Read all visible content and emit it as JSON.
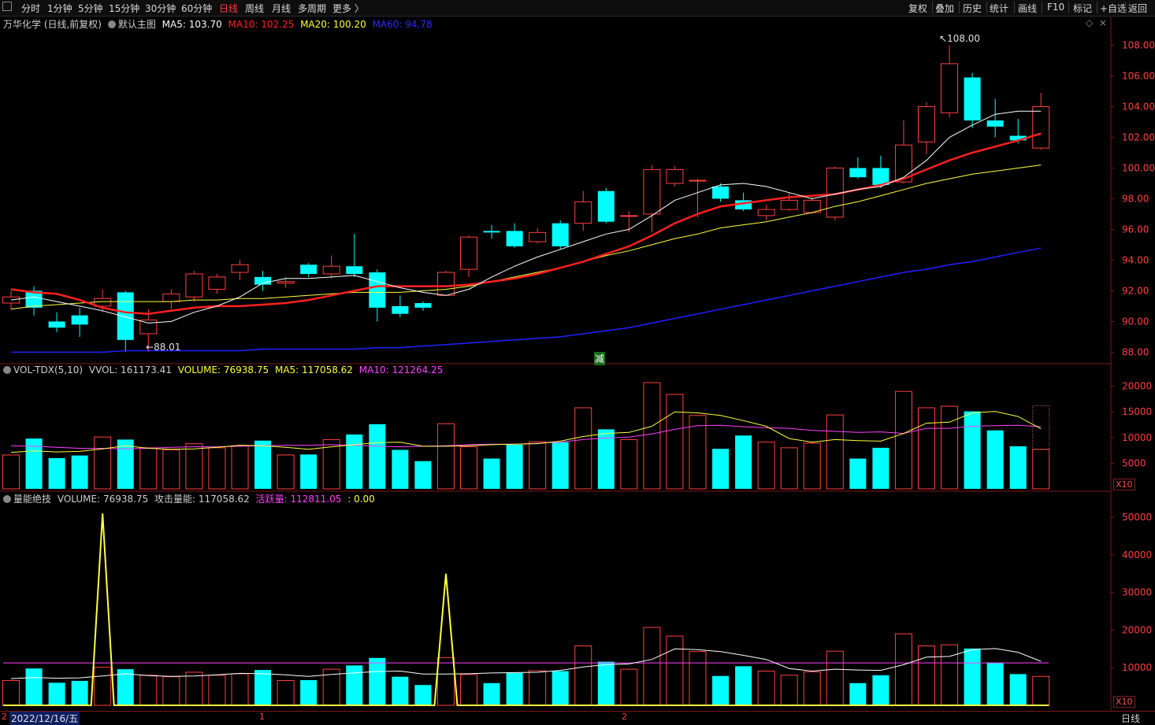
{
  "toolbar": {
    "left_icon": "sidebar-toggle-icon",
    "periods": [
      "分时",
      "1分钟",
      "5分钟",
      "15分钟",
      "30分钟",
      "60分钟",
      "日线",
      "周线",
      "月线",
      "多周期",
      "更多 〉"
    ],
    "active_period": "日线",
    "right_buttons": [
      "复权",
      "叠加",
      "历史",
      "统计",
      "画线",
      "F10",
      "标记",
      "+自选",
      "返回"
    ]
  },
  "main_panel": {
    "title": "万华化学 (日线,前复权)",
    "indicator_name": "默认主图",
    "ma5_label": "MA5: 103.70",
    "ma10_label": "MA10: 102.25",
    "ma20_label": "MA20: 100.20",
    "ma60_label": "MA60: 94.78",
    "high_marker": "108.00",
    "low_marker": "88.01",
    "event_marker": "减",
    "price_ticks": [
      "108.00",
      "106.00",
      "104.00",
      "102.00",
      "100.00",
      "98.00",
      "96.00",
      "94.00",
      "92.00",
      "90.00",
      "88.00"
    ],
    "colors": {
      "ma5": "#ffffff",
      "ma10": "#ff2020",
      "ma20": "#ffff40",
      "ma60": "#2020ff",
      "up": "#ff4040",
      "down": "#00ffff"
    }
  },
  "vol_panel": {
    "title": "VOL-TDX(5,10)",
    "vvol_label": "VVOL: 161173.41",
    "volume_label": "VOLUME: 76938.75",
    "ma5_label": "MA5: 117058.62",
    "ma10_label": "MA10: 121264.25",
    "ticks": [
      "20000",
      "15000",
      "10000",
      "5000"
    ],
    "unit": "X10"
  },
  "energy_panel": {
    "title": "量能绝技",
    "volume_label": "VOLUME: 76938.75",
    "attack_label": "攻击量能: 117058.62",
    "active_label": "活跃量: 112811.05",
    "signal_label": ": 0.00",
    "ticks": [
      "50000",
      "40000",
      "30000",
      "20000",
      "10000"
    ],
    "unit": "X10"
  },
  "status_bar": {
    "date": "2022/12/16/五",
    "month_marks": [
      "1",
      "2"
    ],
    "period": "日线"
  },
  "chart_data": {
    "type": "candlestick",
    "price_range": [
      87.2,
      109.0
    ],
    "candles": [
      {
        "o": 91.2,
        "c": 91.6,
        "h": 92.0,
        "l": 90.8
      },
      {
        "o": 92.0,
        "c": 90.9,
        "h": 92.3,
        "l": 90.4
      },
      {
        "o": 90.0,
        "c": 89.6,
        "h": 90.6,
        "l": 89.3
      },
      {
        "o": 90.4,
        "c": 89.8,
        "h": 90.9,
        "l": 89.0
      },
      {
        "o": 91.0,
        "c": 91.5,
        "h": 92.1,
        "l": 90.6
      },
      {
        "o": 91.9,
        "c": 88.8,
        "h": 92.0,
        "l": 88.0
      },
      {
        "o": 89.2,
        "c": 90.1,
        "h": 90.8,
        "l": 88.01
      },
      {
        "o": 91.3,
        "c": 91.8,
        "h": 92.1,
        "l": 90.8
      },
      {
        "o": 91.6,
        "c": 93.1,
        "h": 93.3,
        "l": 91.3
      },
      {
        "o": 92.1,
        "c": 92.9,
        "h": 93.1,
        "l": 91.8
      },
      {
        "o": 93.2,
        "c": 93.7,
        "h": 94.0,
        "l": 92.7
      },
      {
        "o": 92.9,
        "c": 92.4,
        "h": 93.3,
        "l": 92.0
      },
      {
        "o": 92.5,
        "c": 92.6,
        "h": 92.9,
        "l": 92.2
      },
      {
        "o": 93.7,
        "c": 93.1,
        "h": 93.8,
        "l": 92.9
      },
      {
        "o": 93.1,
        "c": 93.6,
        "h": 94.3,
        "l": 92.8
      },
      {
        "o": 93.6,
        "c": 93.1,
        "h": 95.7,
        "l": 92.9
      },
      {
        "o": 93.2,
        "c": 90.9,
        "h": 93.4,
        "l": 90.0
      },
      {
        "o": 91.0,
        "c": 90.5,
        "h": 91.7,
        "l": 90.3
      },
      {
        "o": 91.2,
        "c": 90.9,
        "h": 91.3,
        "l": 90.7
      },
      {
        "o": 91.7,
        "c": 93.2,
        "h": 93.3,
        "l": 91.7
      },
      {
        "o": 93.4,
        "c": 95.5,
        "h": 95.6,
        "l": 92.9
      },
      {
        "o": 95.9,
        "c": 95.8,
        "h": 96.3,
        "l": 95.4
      },
      {
        "o": 95.9,
        "c": 94.9,
        "h": 96.4,
        "l": 94.8
      },
      {
        "o": 95.2,
        "c": 95.8,
        "h": 96.1,
        "l": 95.1
      },
      {
        "o": 96.4,
        "c": 94.9,
        "h": 96.6,
        "l": 94.7
      },
      {
        "o": 96.4,
        "c": 97.8,
        "h": 98.5,
        "l": 95.9
      },
      {
        "o": 98.5,
        "c": 96.5,
        "h": 98.7,
        "l": 96.4
      },
      {
        "o": 96.9,
        "c": 96.9,
        "h": 97.2,
        "l": 95.8
      },
      {
        "o": 97.0,
        "c": 99.9,
        "h": 100.2,
        "l": 95.8
      },
      {
        "o": 99.0,
        "c": 99.9,
        "h": 100.1,
        "l": 98.8
      },
      {
        "o": 99.2,
        "c": 99.2,
        "h": 99.3,
        "l": 96.8
      },
      {
        "o": 98.8,
        "c": 98.0,
        "h": 99.0,
        "l": 97.8
      },
      {
        "o": 97.9,
        "c": 97.3,
        "h": 98.4,
        "l": 97.2
      },
      {
        "o": 96.9,
        "c": 97.3,
        "h": 97.6,
        "l": 96.6
      },
      {
        "o": 97.3,
        "c": 97.9,
        "h": 98.4,
        "l": 97.2
      },
      {
        "o": 97.1,
        "c": 97.9,
        "h": 98.1,
        "l": 97.0
      },
      {
        "o": 96.8,
        "c": 100.0,
        "h": 100.1,
        "l": 96.6
      },
      {
        "o": 100.0,
        "c": 99.4,
        "h": 100.7,
        "l": 99.3
      },
      {
        "o": 100.0,
        "c": 98.9,
        "h": 100.8,
        "l": 98.7
      },
      {
        "o": 99.1,
        "c": 101.5,
        "h": 103.1,
        "l": 99.0
      },
      {
        "o": 101.7,
        "c": 104.0,
        "h": 104.3,
        "l": 100.9
      },
      {
        "o": 103.6,
        "c": 106.8,
        "h": 108.0,
        "l": 103.3
      },
      {
        "o": 105.9,
        "c": 103.1,
        "h": 106.2,
        "l": 102.6
      },
      {
        "o": 103.1,
        "c": 102.7,
        "h": 104.5,
        "l": 102.0
      },
      {
        "o": 102.1,
        "c": 101.8,
        "h": 103.2,
        "l": 101.6
      },
      {
        "o": 101.3,
        "c": 104.0,
        "h": 104.9,
        "l": 101.2
      }
    ],
    "ma5": [
      91.4,
      91.6,
      91.3,
      91.0,
      90.7,
      90.3,
      89.9,
      90.0,
      90.6,
      91.0,
      91.6,
      92.5,
      92.8,
      92.8,
      92.9,
      93.0,
      92.6,
      92.2,
      91.9,
      91.7,
      92.1,
      92.9,
      93.6,
      94.2,
      94.7,
      95.2,
      95.7,
      96.0,
      96.9,
      97.9,
      98.4,
      98.9,
      99.0,
      98.8,
      98.4,
      98.0,
      98.3,
      98.6,
      98.8,
      99.4,
      100.5,
      102.0,
      102.8,
      103.5,
      103.7,
      103.7
    ],
    "ma10": [
      92.1,
      91.9,
      91.8,
      91.4,
      90.9,
      90.6,
      90.5,
      90.7,
      90.9,
      91.0,
      91.0,
      91.1,
      91.2,
      91.4,
      91.7,
      92.0,
      92.3,
      92.3,
      92.3,
      92.3,
      92.4,
      92.6,
      92.8,
      93.1,
      93.5,
      93.9,
      94.4,
      94.9,
      95.6,
      96.4,
      97.0,
      97.5,
      97.7,
      97.9,
      98.1,
      98.2,
      98.3,
      98.6,
      98.9,
      99.3,
      99.9,
      100.5,
      101.0,
      101.4,
      101.8,
      102.25
    ],
    "ma20": [
      90.8,
      91.0,
      91.1,
      91.2,
      91.3,
      91.3,
      91.3,
      91.3,
      91.4,
      91.4,
      91.5,
      91.5,
      91.6,
      91.7,
      91.8,
      91.9,
      91.9,
      91.9,
      92.0,
      92.1,
      92.3,
      92.6,
      92.9,
      93.2,
      93.5,
      93.9,
      94.3,
      94.6,
      95.0,
      95.4,
      95.7,
      96.1,
      96.3,
      96.5,
      96.8,
      97.1,
      97.5,
      97.8,
      98.2,
      98.6,
      99.0,
      99.3,
      99.6,
      99.8,
      100.0,
      100.2
    ],
    "ma60": [
      88.0,
      88.0,
      88.0,
      88.0,
      88.0,
      88.1,
      88.1,
      88.1,
      88.1,
      88.1,
      88.1,
      88.2,
      88.2,
      88.2,
      88.2,
      88.2,
      88.3,
      88.3,
      88.4,
      88.5,
      88.6,
      88.7,
      88.8,
      88.9,
      89.0,
      89.2,
      89.4,
      89.6,
      89.9,
      90.2,
      90.5,
      90.8,
      91.1,
      91.4,
      91.7,
      92.0,
      92.3,
      92.6,
      92.9,
      93.2,
      93.4,
      93.7,
      93.9,
      94.2,
      94.5,
      94.78
    ],
    "volumes": [
      6600,
      9800,
      6000,
      6500,
      10100,
      9600,
      8000,
      7600,
      8800,
      8000,
      8400,
      9400,
      6600,
      6700,
      9600,
      10600,
      12600,
      7600,
      5400,
      12700,
      8200,
      5900,
      8600,
      9200,
      9100,
      15800,
      11600,
      9600,
      20700,
      18400,
      14300,
      7800,
      10400,
      9100,
      8000,
      8900,
      14400,
      5900,
      8000,
      19000,
      15800,
      16100,
      15100,
      11400,
      8300,
      7694
    ],
    "vol_ma5": [
      7100,
      7400,
      7200,
      7300,
      7800,
      8400,
      7900,
      7700,
      7800,
      8100,
      8500,
      8400,
      8100,
      7700,
      8200,
      8600,
      9000,
      9100,
      8300,
      8300,
      8400,
      8600,
      8700,
      8800,
      9300,
      10200,
      10800,
      11000,
      12200,
      15000,
      14800,
      14300,
      13300,
      12200,
      9800,
      9100,
      9600,
      9400,
      9300,
      10800,
      12800,
      13000,
      14800,
      15100,
      14100,
      11706
    ],
    "vol_ma10": [
      8400,
      8300,
      8100,
      7900,
      7900,
      7800,
      7900,
      8100,
      8200,
      8200,
      8300,
      8400,
      8500,
      8500,
      8600,
      8500,
      8300,
      8200,
      8300,
      8400,
      8600,
      8700,
      8700,
      8900,
      9100,
      9600,
      9900,
      10100,
      10700,
      11600,
      12300,
      12400,
      12100,
      11900,
      11800,
      11400,
      11200,
      11000,
      11100,
      10800,
      11800,
      11800,
      12200,
      12300,
      12400,
      12126
    ],
    "signal": [
      0,
      0,
      0,
      0,
      51000,
      0,
      0,
      0,
      0,
      0,
      0,
      0,
      0,
      0,
      0,
      0,
      0,
      0,
      0,
      35000,
      0,
      0,
      0,
      0,
      0,
      0,
      0,
      0,
      0,
      0,
      0,
      0,
      0,
      0,
      0,
      0,
      0,
      0,
      0,
      0,
      0,
      0,
      0,
      0,
      0,
      0
    ]
  }
}
